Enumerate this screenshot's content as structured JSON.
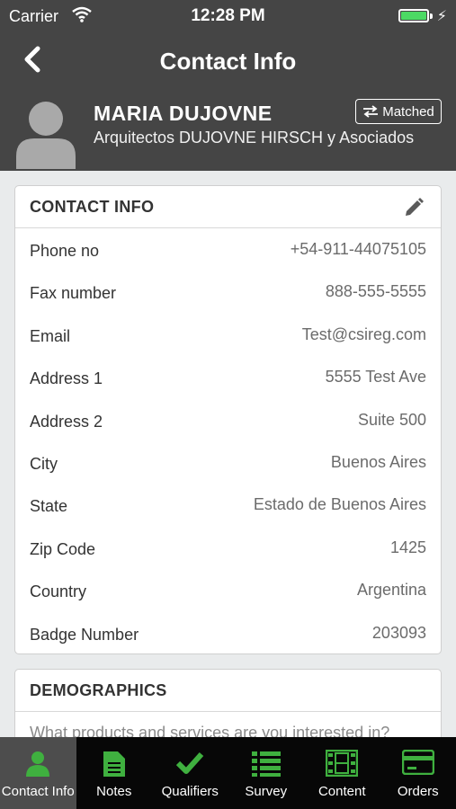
{
  "status": {
    "carrier": "Carrier",
    "time": "12:28 PM",
    "battery_level": 1.0
  },
  "nav": {
    "title": "Contact Info"
  },
  "contact": {
    "name": "MARIA DUJOVNE",
    "company": "Arquitectos DUJOVNE HIRSCH y Asociados",
    "match_badge": "Matched"
  },
  "contact_card": {
    "title": "CONTACT INFO",
    "rows": [
      {
        "label": "Phone no",
        "value": "+54-911-44075105"
      },
      {
        "label": "Fax number",
        "value": "888-555-5555"
      },
      {
        "label": "Email",
        "value": "Test@csireg.com"
      },
      {
        "label": "Address 1",
        "value": "5555 Test Ave"
      },
      {
        "label": "Address 2",
        "value": "Suite 500"
      },
      {
        "label": "City",
        "value": "Buenos Aires"
      },
      {
        "label": "State",
        "value": "Estado de Buenos Aires"
      },
      {
        "label": "Zip Code",
        "value": "1425"
      },
      {
        "label": "Country",
        "value": "Argentina"
      },
      {
        "label": "Badge Number",
        "value": "203093"
      }
    ]
  },
  "demographics_card": {
    "title": "DEMOGRAPHICS",
    "question": "What products and services are you interested in?"
  },
  "tabs": [
    {
      "label": "Contact Info",
      "icon": "person-icon",
      "active": true
    },
    {
      "label": "Notes",
      "icon": "note-icon",
      "active": false
    },
    {
      "label": "Qualifiers",
      "icon": "checkmark-icon",
      "active": false
    },
    {
      "label": "Survey",
      "icon": "list-icon",
      "active": false
    },
    {
      "label": "Content",
      "icon": "film-icon",
      "active": false
    },
    {
      "label": "Orders",
      "icon": "credit-card-icon",
      "active": false
    }
  ],
  "colors": {
    "header_bg": "#454545",
    "tab_accent": "#3fb03f",
    "tabbar_bg": "#070707",
    "active_tab_bg": "#4d4d4d",
    "battery": "#4cd964"
  }
}
